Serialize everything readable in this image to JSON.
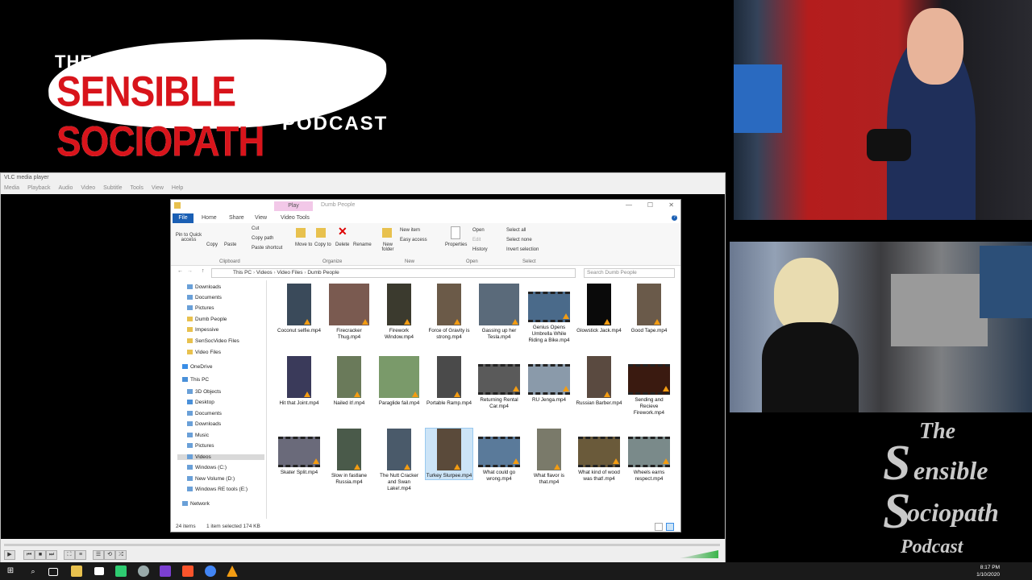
{
  "logo": {
    "the": "THE",
    "main": "SENSIBLE SOCIOPATH",
    "podcast": "PODCAST"
  },
  "watermark": {
    "the": "The",
    "s1": "S",
    "ensible": "ensible",
    "s2": "S",
    "ociopath": "ociopath",
    "podcast": "Podcast"
  },
  "vlc": {
    "title": "VLC media player",
    "menu": [
      "Media",
      "Playback",
      "Audio",
      "Video",
      "Subtitle",
      "Tools",
      "View",
      "Help"
    ]
  },
  "explorer": {
    "play_tab": "Play",
    "window_title": "Dumb People",
    "ribbon_tabs": [
      "File",
      "Home",
      "Share",
      "View",
      "Video Tools"
    ],
    "ribbon": {
      "pin": "Pin to Quick access",
      "copy": "Copy",
      "paste": "Paste",
      "cut": "Cut",
      "copy_path": "Copy path",
      "paste_shortcut": "Paste shortcut",
      "move_to": "Move to",
      "copy_to": "Copy to",
      "delete": "Delete",
      "rename": "Rename",
      "new_folder": "New folder",
      "new_item": "New item",
      "easy_access": "Easy access",
      "properties": "Properties",
      "open": "Open",
      "edit": "Edit",
      "history": "History",
      "select_all": "Select all",
      "select_none": "Select none",
      "invert_selection": "Invert selection",
      "groups": [
        "Clipboard",
        "Organize",
        "New",
        "Open",
        "Select"
      ]
    },
    "address": [
      "This PC",
      "Videos",
      "Video Files",
      "Dumb People"
    ],
    "search_placeholder": "Search Dumb People",
    "nav": [
      {
        "label": "Downloads",
        "icon": "download-icon"
      },
      {
        "label": "Documents",
        "icon": "document-icon"
      },
      {
        "label": "Pictures",
        "icon": "picture-icon"
      },
      {
        "label": "Dumb People",
        "icon": "folder-icon"
      },
      {
        "label": "Impessive",
        "icon": "folder-icon"
      },
      {
        "label": "SenSocVideo Files",
        "icon": "folder-icon"
      },
      {
        "label": "Video Files",
        "icon": "folder-icon"
      },
      {
        "label": "OneDrive",
        "icon": "cloud-icon"
      },
      {
        "label": "This PC",
        "icon": "computer-icon"
      },
      {
        "label": "3D Objects",
        "icon": "cube-icon"
      },
      {
        "label": "Desktop",
        "icon": "desktop-icon"
      },
      {
        "label": "Documents",
        "icon": "document-icon"
      },
      {
        "label": "Downloads",
        "icon": "download-icon"
      },
      {
        "label": "Music",
        "icon": "music-icon"
      },
      {
        "label": "Pictures",
        "icon": "picture-icon"
      },
      {
        "label": "Videos",
        "icon": "video-icon"
      },
      {
        "label": "Windows (C:)",
        "icon": "drive-icon"
      },
      {
        "label": "New Volume (D:)",
        "icon": "drive-icon"
      },
      {
        "label": "Windows RE tools (E:)",
        "icon": "drive-icon"
      },
      {
        "label": "Network",
        "icon": "network-icon"
      }
    ],
    "files": [
      {
        "name": "Coconut selfie.mp4",
        "color": "#3a4a5a",
        "shape": "portrait"
      },
      {
        "name": "Firecracker Thug.mp4",
        "color": "#7a5a50",
        "shape": "square"
      },
      {
        "name": "Firework Window.mp4",
        "color": "#3b3a2e",
        "shape": "portrait"
      },
      {
        "name": "Force of Gravity is strong.mp4",
        "color": "#6b5a48",
        "shape": "portrait"
      },
      {
        "name": "Gassing up her Tesla.mp4",
        "color": "#5a6a7a",
        "shape": "square"
      },
      {
        "name": "Genius Opens Umbrella While Riding a Bike.mp4",
        "color": "#4a6a8a",
        "shape": "film"
      },
      {
        "name": "Glowstick Jack.mp4",
        "color": "#0a0a0a",
        "shape": "portrait"
      },
      {
        "name": "Good Tape.mp4",
        "color": "#6a5a4a",
        "shape": "portrait"
      },
      {
        "name": "Hit that Joint.mp4",
        "color": "#3a3a5a",
        "shape": "portrait"
      },
      {
        "name": "Nailed it!.mp4",
        "color": "#6a7a5a",
        "shape": "portrait"
      },
      {
        "name": "Paraglide fail.mp4",
        "color": "#7a9a6a",
        "shape": "square"
      },
      {
        "name": "Portable Ramp.mp4",
        "color": "#4a4a4a",
        "shape": "portrait"
      },
      {
        "name": "Returning Rental Car.mp4",
        "color": "#5a5a5a",
        "shape": "film"
      },
      {
        "name": "RU Jenga.mp4",
        "color": "#8a9aaa",
        "shape": "film"
      },
      {
        "name": "Russian Barber.mp4",
        "color": "#5a4a40",
        "shape": "portrait"
      },
      {
        "name": "Sending and Recieve Firework.mp4",
        "color": "#3a1a10",
        "shape": "film"
      },
      {
        "name": "Skater Split.mp4",
        "color": "#6a6a7a",
        "shape": "film"
      },
      {
        "name": "Slow in fastlane Russia.mp4",
        "color": "#4a5a4a",
        "shape": "portrait"
      },
      {
        "name": "The Nutt Cracker and Swan Lake!.mp4",
        "color": "#4a5a6a",
        "shape": "portrait"
      },
      {
        "name": "Turkey Slurpee.mp4",
        "color": "#5a4a3a",
        "shape": "portrait"
      },
      {
        "name": "What could go wrong.mp4",
        "color": "#5a7a9a",
        "shape": "film"
      },
      {
        "name": "What flavor is that.mp4",
        "color": "#7a7a6a",
        "shape": "portrait"
      },
      {
        "name": "What kind of wood was that!.mp4",
        "color": "#6a5a3a",
        "shape": "film"
      },
      {
        "name": "Wheels earns respect.mp4",
        "color": "#7a8a8a",
        "shape": "film"
      }
    ],
    "status_count": "24 items",
    "status_selected": "1 item selected  174 KB"
  },
  "taskbar": {
    "time": "8:17 PM",
    "date": "1/10/2020"
  }
}
